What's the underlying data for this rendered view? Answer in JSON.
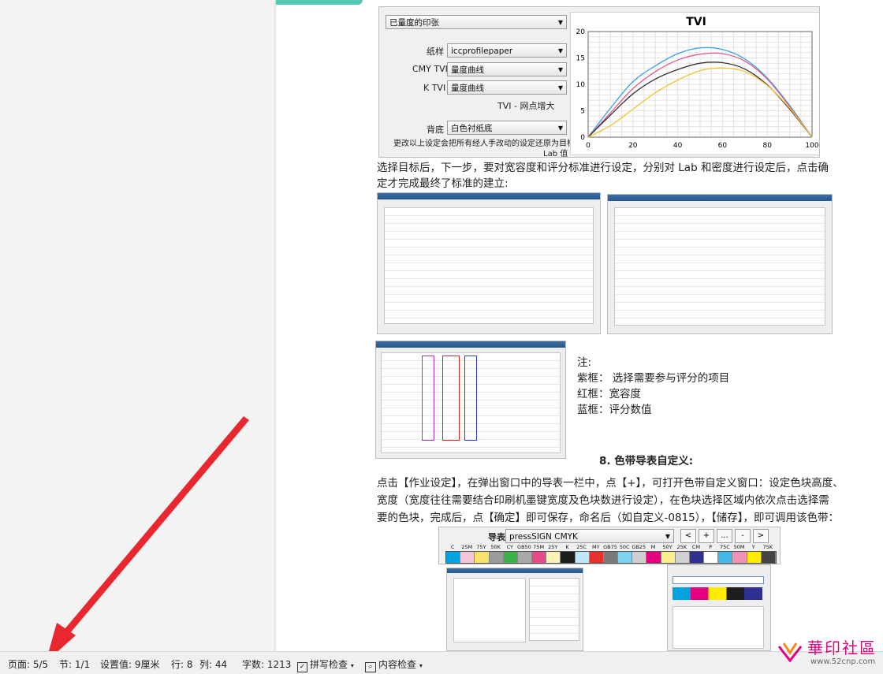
{
  "tvi_panel": {
    "dropdown_top": "已量度的印张",
    "paper_label": "纸样",
    "paper_value": "iccprofilepaper",
    "cmy_label": "CMY TVI",
    "cmy_value": "量度曲线",
    "k_label": "K TVI",
    "k_value": "量度曲线",
    "tvi_caption": "TVI - 网点增大",
    "bg_label": "背底",
    "bg_value": "白色衬纸底",
    "note_line1": "更改以上设定会把所有经人手改动的设定还原为目标",
    "note_line2": "Lab 值"
  },
  "chart_data": {
    "type": "line",
    "title": "TVI",
    "x": [
      0,
      10,
      20,
      30,
      40,
      50,
      60,
      70,
      80,
      90,
      100
    ],
    "xlim": [
      0,
      100
    ],
    "ylim": [
      0,
      20
    ],
    "xticks": [
      "0",
      "20",
      "40",
      "60",
      "80",
      "100"
    ],
    "yticks": [
      "0",
      "5",
      "10",
      "15",
      "20"
    ],
    "grid": true,
    "series": [
      {
        "color": "#3aa0dc",
        "values": [
          0,
          5.5,
          10.5,
          13.5,
          15.8,
          16.9,
          16.6,
          14.8,
          11.2,
          6,
          0
        ]
      },
      {
        "color": "#e05c8c",
        "values": [
          0,
          4.6,
          9.2,
          12.4,
          14.6,
          15.7,
          15.8,
          14.4,
          11,
          5.8,
          0
        ]
      },
      {
        "color": "#333333",
        "values": [
          0,
          4.2,
          8.2,
          11,
          12.8,
          14,
          14.1,
          12.9,
          9.9,
          5.3,
          0
        ]
      },
      {
        "color": "#f2c230",
        "values": [
          0,
          2.2,
          5.3,
          8.4,
          10.8,
          12.6,
          13.1,
          12.4,
          9.8,
          5.5,
          0
        ]
      }
    ]
  },
  "paragraphs": {
    "p1_line1": "选择目标后，下一步，要对宽容度和评分标准进行设定，分别对 Lab 和密度进行设定后，点击确",
    "p1_line2": "定才完成最终了标准的建立:",
    "note_title": "注:",
    "note_purple": "紫框：   选择需要参与评分的项目",
    "note_red": "红框：宽容度",
    "note_blue": "蓝框：评分数值",
    "section_heading": "8.   色带导表自定义:",
    "p2_line1": "点击【作业设定】，在弹出窗口中的导表一栏中，点【+】，可打开色带自定义窗口：设定色块高度、",
    "p2_line2": "宽度（宽度往往需要结合印刷机墨键宽度及色块数进行设定），在色块选择区域内依次点击选择需",
    "p2_line3": "要的色块，完成后，点【确定】即可保存，命名后（如自定义-0815），【储存】，即可调用该色带："
  },
  "strip_panel": {
    "label": "导表",
    "dropdown_value": "pressSIGN CMYK",
    "buttons": [
      "<",
      "+",
      "...",
      "-",
      ">"
    ],
    "patch_labels": [
      "C",
      "25M",
      "75Y",
      "50K",
      "CY",
      "GB50",
      "75M",
      "25Y",
      "K",
      "25C",
      "MY",
      "GB75",
      "50C",
      "GB25",
      "M",
      "50Y",
      "25K",
      "CM",
      "P",
      "75C",
      "50M",
      "Y",
      "75K"
    ],
    "patch_colors": [
      "#00a3e0",
      "#f5c6d9",
      "#f8e36a",
      "#9b9b9b",
      "#39b24a",
      "#a9a9a9",
      "#e64b88",
      "#fbf2b6",
      "#1e1e1e",
      "#bfe7f7",
      "#e8302e",
      "#7a7a7a",
      "#7fd1f0",
      "#cfcfcf",
      "#e4007f",
      "#fcee8a",
      "#d0d0d0",
      "#2e3192",
      "#ffffff",
      "#3fb9e8",
      "#ef90b8",
      "#ffec00",
      "#444444"
    ]
  },
  "status_bar": {
    "page": "页面: 5/5",
    "section": "节: 1/1",
    "position": "设置值: 9厘米",
    "row": "行: 8",
    "col": "列: 44",
    "words": "字数: 1213",
    "spell": "拼写检查",
    "content": "内容检查"
  },
  "watermark": {
    "brand": "華印社區",
    "url": "www.52cnp.com"
  },
  "colors": {
    "arrow": "#e8282e",
    "accent": "#54c8b0",
    "purple_frame": "#b030c0",
    "red_frame": "#e02020",
    "blue_frame": "#3040e0"
  }
}
